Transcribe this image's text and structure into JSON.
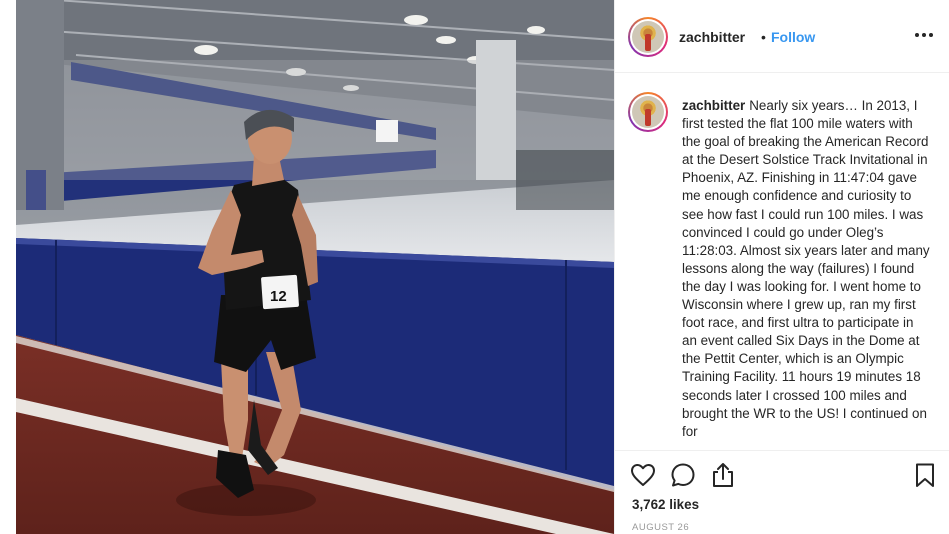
{
  "post": {
    "username": "zachbitter",
    "separator": "•",
    "follow_label": "Follow",
    "caption_username": "zachbitter",
    "caption_text": "Nearly six years… In 2013, I first tested the flat 100 mile waters with the goal of breaking the American Record at the Desert Solstice Track Invitational in Phoenix, AZ. Finishing in 11:47:04 gave me enough confidence and curiosity to see how fast I could run 100 miles. I was convinced I could go under Oleg’s 11:28:03. Almost six years later and many lessons along the way (failures) I found the day I was looking for. I went home to Wisconsin where I grew up, ran my first foot race, and first ultra to participate in an event called Six Days in the Dome at the Pettit Center, which is an Olympic Training Facility. 11 hours 19 minutes 18 seconds later I crossed 100 miles and brought the WR to the US! I continued on for",
    "likes": "3,762 likes",
    "date": "AUGUST 26",
    "bib_number": "12"
  },
  "icons": {
    "more": "more-options-icon",
    "like": "heart-icon",
    "comment": "comment-icon",
    "share": "share-icon",
    "save": "bookmark-icon"
  },
  "colors": {
    "follow_blue": "#3897f0",
    "text": "#262626",
    "muted": "#999999",
    "divider": "#efefef"
  }
}
